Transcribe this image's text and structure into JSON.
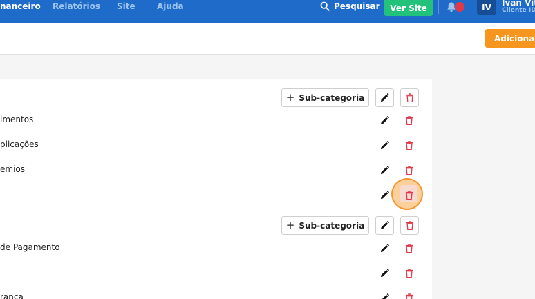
{
  "nav": {
    "items": [
      "nanceiro",
      "Relatórios",
      "Site",
      "Ajuda"
    ],
    "search_label": "Pesquisar",
    "site_button": "Ver Site",
    "avatar_initials": "IV",
    "user_name": "Ivan Vito",
    "client_id": "Cliente ID:"
  },
  "subheader": {
    "add_button": "Adicionar c"
  },
  "groups": [
    {
      "subcategory_button": "Sub-categoria",
      "items": [
        "imentos",
        "plicações",
        "emios",
        ""
      ]
    },
    {
      "subcategory_button": "Sub-categoria",
      "items": [
        "de Pagamento",
        "",
        "rança"
      ]
    }
  ],
  "colors": {
    "nav_bg": "#1f6bc9",
    "site_button": "#23c27a",
    "add_button": "#f7961e",
    "delete_icon": "#e0394a"
  }
}
